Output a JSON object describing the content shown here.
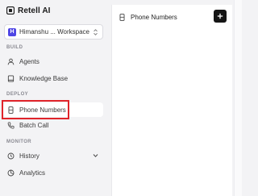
{
  "app": {
    "name": "Retell AI"
  },
  "workspace": {
    "initial": "H",
    "name": "Himanshu ... Workspace"
  },
  "sidebar": {
    "sections": [
      {
        "label": "BUILD"
      },
      {
        "label": "DEPLOY"
      },
      {
        "label": "MONITOR"
      }
    ],
    "items": [
      {
        "label": "Agents",
        "icon": "user-icon"
      },
      {
        "label": "Knowledge Base",
        "icon": "book-icon"
      },
      {
        "label": "Phone Numbers",
        "icon": "phone-device-icon",
        "active": true
      },
      {
        "label": "Batch Call",
        "icon": "phone-icon"
      },
      {
        "label": "History",
        "icon": "history-icon"
      },
      {
        "label": "Analytics",
        "icon": "chart-icon"
      }
    ]
  },
  "main": {
    "title": "Phone Numbers",
    "add_button_icon": "plus-icon"
  },
  "colors": {
    "highlight": "#e0242a",
    "accent": "#4f46e5",
    "button_bg": "#151515"
  }
}
